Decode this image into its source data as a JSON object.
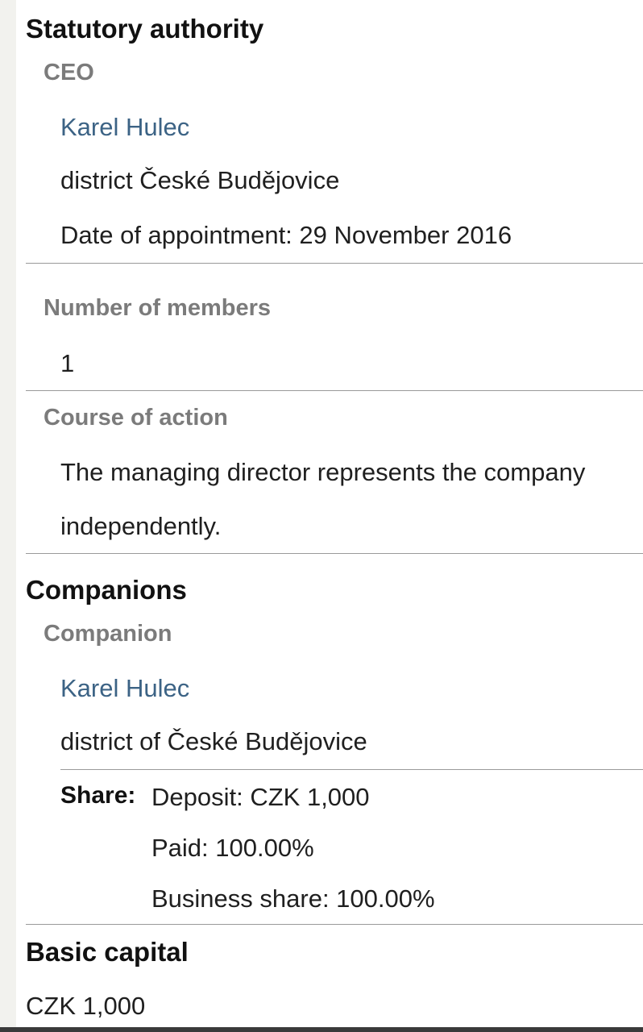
{
  "statutory_authority": {
    "heading": "Statutory authority",
    "role": "CEO",
    "person_name": "Karel Hulec",
    "district": "district České Budějovice",
    "appointment": "Date of appointment: 29 November 2016",
    "members_label": "Number of members",
    "members_value": "1",
    "course_label": "Course of action",
    "course_line1": "The managing director represents the company",
    "course_line2": "independently."
  },
  "companions": {
    "heading": "Companions",
    "role": "Companion",
    "person_name": "Karel Hulec",
    "district": "district of České Budějovice",
    "share_label": "Share:",
    "deposit": "Deposit: CZK 1,000",
    "paid": "Paid: 100.00%",
    "business_share": "Business share: 100.00%"
  },
  "basic_capital": {
    "heading": "Basic capital",
    "value": "CZK 1,000"
  }
}
